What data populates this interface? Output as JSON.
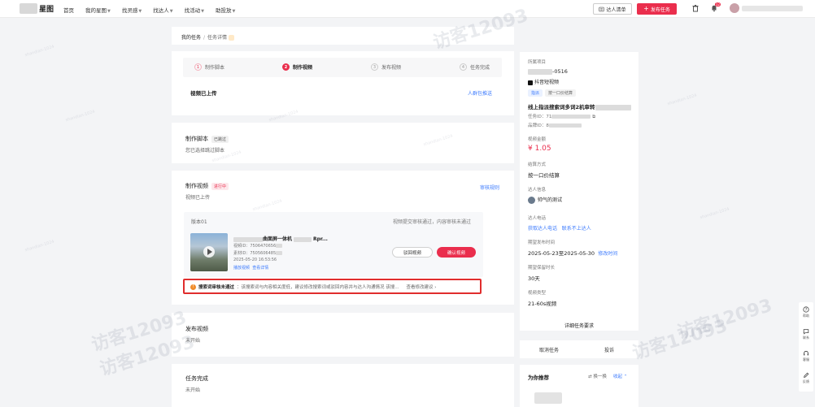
{
  "nav": {
    "brand": "星图",
    "menu": [
      {
        "label": "首页",
        "dropdown": false
      },
      {
        "label": "我的星图",
        "dropdown": true
      },
      {
        "label": "找灵感",
        "dropdown": true
      },
      {
        "label": "找达人",
        "dropdown": true
      },
      {
        "label": "找活动",
        "dropdown": true
      },
      {
        "label": "助投放",
        "dropdown": true
      }
    ],
    "creator_list_label": "达人清单",
    "publish_task_label": "发布任务",
    "notification_count": "12"
  },
  "breadcrumb": {
    "root": "我的任务",
    "separator": "/",
    "current": "任务详情"
  },
  "steps": [
    {
      "num": "1",
      "label": "制作脚本",
      "state": "done"
    },
    {
      "num": "2",
      "label": "制作视频",
      "state": "active"
    },
    {
      "num": "3",
      "label": "发布视频",
      "state": "pending"
    },
    {
      "num": "4",
      "label": "任务完成",
      "state": "pending"
    }
  ],
  "upload_status": {
    "text": "视频已上传",
    "link": "人群包推送"
  },
  "script_section": {
    "title": "制作脚本",
    "badge": "已跳过",
    "desc": "您已选择跳过脚本"
  },
  "video_section": {
    "title": "制作视频",
    "badge": "进行中",
    "desc": "视频已上传",
    "rule_link": "审核规则",
    "version_label": "版本01",
    "review_status": "视频提交审核通过，内容审核未通过",
    "video_title_prefix": "",
    "video_title_mid": "曲面屏一体机",
    "video_title_suffix": "Rpr...",
    "video_id_label": "视频ID：7506470656",
    "item_id_label": "素材ID：7505606485",
    "timestamp": "2025-05-20 16:53:56",
    "links": [
      "播放视频",
      "查看详情"
    ],
    "reject_label": "驳回视频",
    "confirm_label": "确认视频",
    "warning_title": "搜索词审核未通过",
    "warning_text": "：该搜索词与内容相关度低，建议修改搜索词或驳回内容并与达人沟通情况 该搜...",
    "warning_link": "查看修改建议"
  },
  "publish_section": {
    "title": "发布视频",
    "status": "未开始"
  },
  "complete_section": {
    "title": "任务完成",
    "status": "未开始"
  },
  "right_panel": {
    "project_label": "所属项目",
    "project_id_suffix": "-0516",
    "platform_label": "抖音短视频",
    "tags": [
      "指派",
      "按一口价结算"
    ],
    "task_name": "线上指派搜索词多词2机审转",
    "task_id_label": "任务ID：",
    "task_id_prefix": "71",
    "brand_id_label": "品牌ID：",
    "brand_id_prefix": "8",
    "amount_label": "视频金额",
    "amount_value": "¥ 1.05",
    "settle_label": "结算方式",
    "settle_value": "按一口价结算",
    "creator_label": "达人信息",
    "creator_name": "帅气的测试",
    "phone_label": "达人电话",
    "phone_link1": "获取达人电话",
    "phone_link2": "联系不上达人",
    "period_label": "期望发布时间",
    "period_value": "2025-05-23至2025-05-30",
    "period_link": "修改时间",
    "hold_label": "期望保留时长",
    "hold_value": "30天",
    "type_label": "视频类型",
    "type_value": "21-60s视频",
    "detail_link": "详细任务要求",
    "cancel_label": "取消任务",
    "complain_label": "投诉",
    "recommend_title": "为你推荐",
    "refresh_label": "换一换",
    "collapse_label": "收起"
  },
  "side_tools": [
    {
      "label": "帮助",
      "icon": "help-icon"
    },
    {
      "label": "联系",
      "icon": "chat-icon"
    },
    {
      "label": "客服",
      "icon": "headset-icon"
    },
    {
      "label": "反馈",
      "icon": "edit-icon"
    }
  ],
  "watermark": {
    "text": "访客12093",
    "small_text": "shandian-1024"
  },
  "colors": {
    "primary": "#ea2e4d",
    "link": "#3d7bfd",
    "warning_border": "#e02d2d"
  }
}
